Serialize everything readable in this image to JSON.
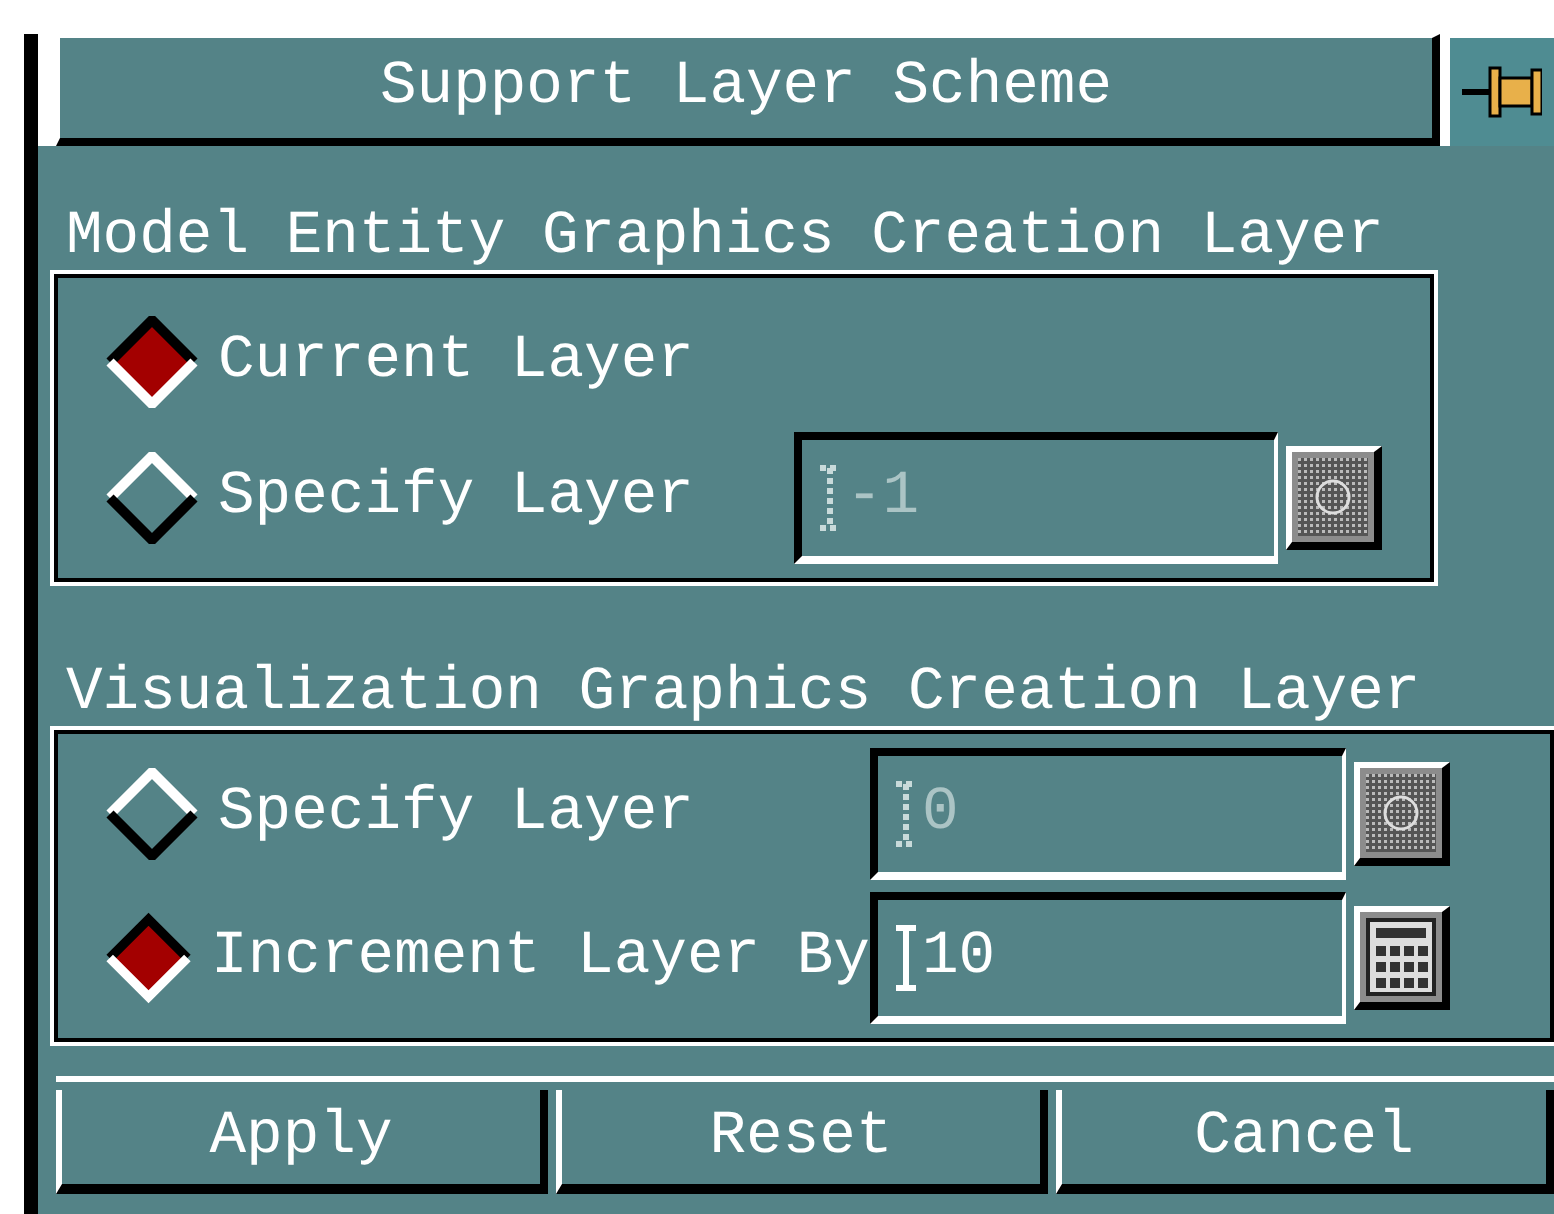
{
  "window": {
    "title": "Support Layer Scheme"
  },
  "groups": [
    {
      "label": "Model Entity Graphics Creation Layer",
      "options": [
        {
          "label": "Current Layer",
          "selected": true
        },
        {
          "label": "Specify Layer",
          "selected": false,
          "field": {
            "value": "-1",
            "disabled": true
          }
        }
      ]
    },
    {
      "label": "Visualization Graphics Creation Layer",
      "options": [
        {
          "label": "Specify Layer",
          "selected": false,
          "field": {
            "value": "0",
            "disabled": true
          }
        },
        {
          "label": "Increment Layer By",
          "selected": true,
          "field": {
            "value": "10",
            "disabled": false
          }
        }
      ]
    }
  ],
  "buttons": [
    "Apply",
    "Reset",
    "Cancel"
  ]
}
